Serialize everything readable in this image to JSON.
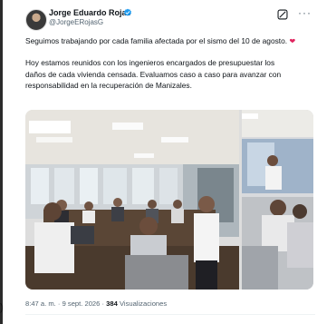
{
  "post": {
    "author_name": "Jorge Eduardo Rojas",
    "author_handle": "@JorgeERojasG",
    "paragraph1": "Seguimos trabajando por cada familia afectada por el sismo del 10 de agosto.",
    "paragraph2": "Hoy estamos reunidos con los ingenieros encargados de presupuestar los daños de cada vivienda censada. Evaluamos caso a caso para avanzar con responsabilidad en la recuperación de Manizales.",
    "emoji": "heart-emoji",
    "time": "8:47 a. m.",
    "date": "9 sept. 2026",
    "separator": "·",
    "views_count": "384",
    "views_label": "Visualizaciones"
  },
  "left_edge_glyph": ")",
  "colors": {
    "verified": "#1d9bf0",
    "secondary_text": "#536471",
    "heart": "#e0245e"
  },
  "icons": [
    "verified-badge-icon",
    "grok-icon",
    "more-options-icon"
  ]
}
